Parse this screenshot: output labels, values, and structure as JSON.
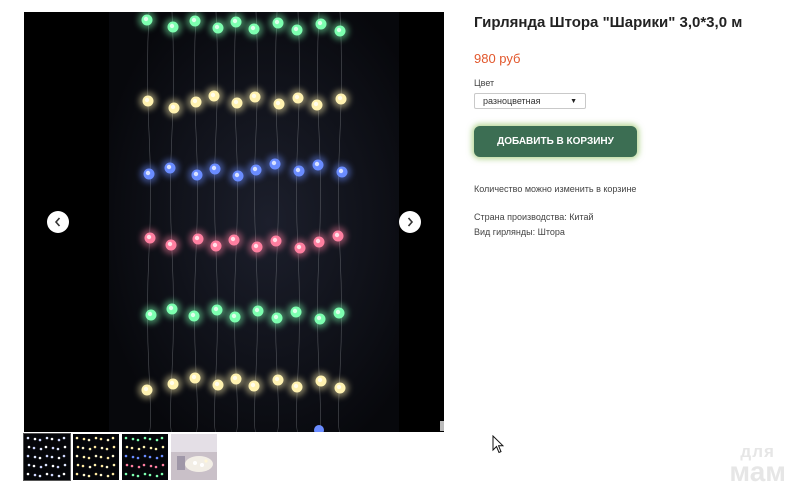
{
  "product": {
    "title": "Гирлянда Штора \"Шарики\" 3,0*3,0 м",
    "price": "980 руб"
  },
  "options": {
    "color_label": "Цвет",
    "color_selected": "разноцветная"
  },
  "actions": {
    "add_to_cart": "ДОБАВИТЬ В КОРЗИНУ"
  },
  "info": {
    "quantity_note": "Количество можно изменить в корзине",
    "specs": [
      "Страна производства: Китай",
      "Вид гирлянды: Штора"
    ]
  },
  "gallery": {
    "prev_icon": "chevron-left-icon",
    "next_icon": "chevron-right-icon",
    "thumbnail_count": 4,
    "active_thumbnail": 1
  },
  "watermark": {
    "line1": "для",
    "line2": "мам"
  },
  "colors": {
    "price": "#e2572c",
    "button": "#3c6e53",
    "button_glow": "#78b43c",
    "light_green": "#7dffb0",
    "light_yellow": "#fff2b0",
    "light_blue": "#6a8cff",
    "light_pink": "#ff7fa0"
  }
}
